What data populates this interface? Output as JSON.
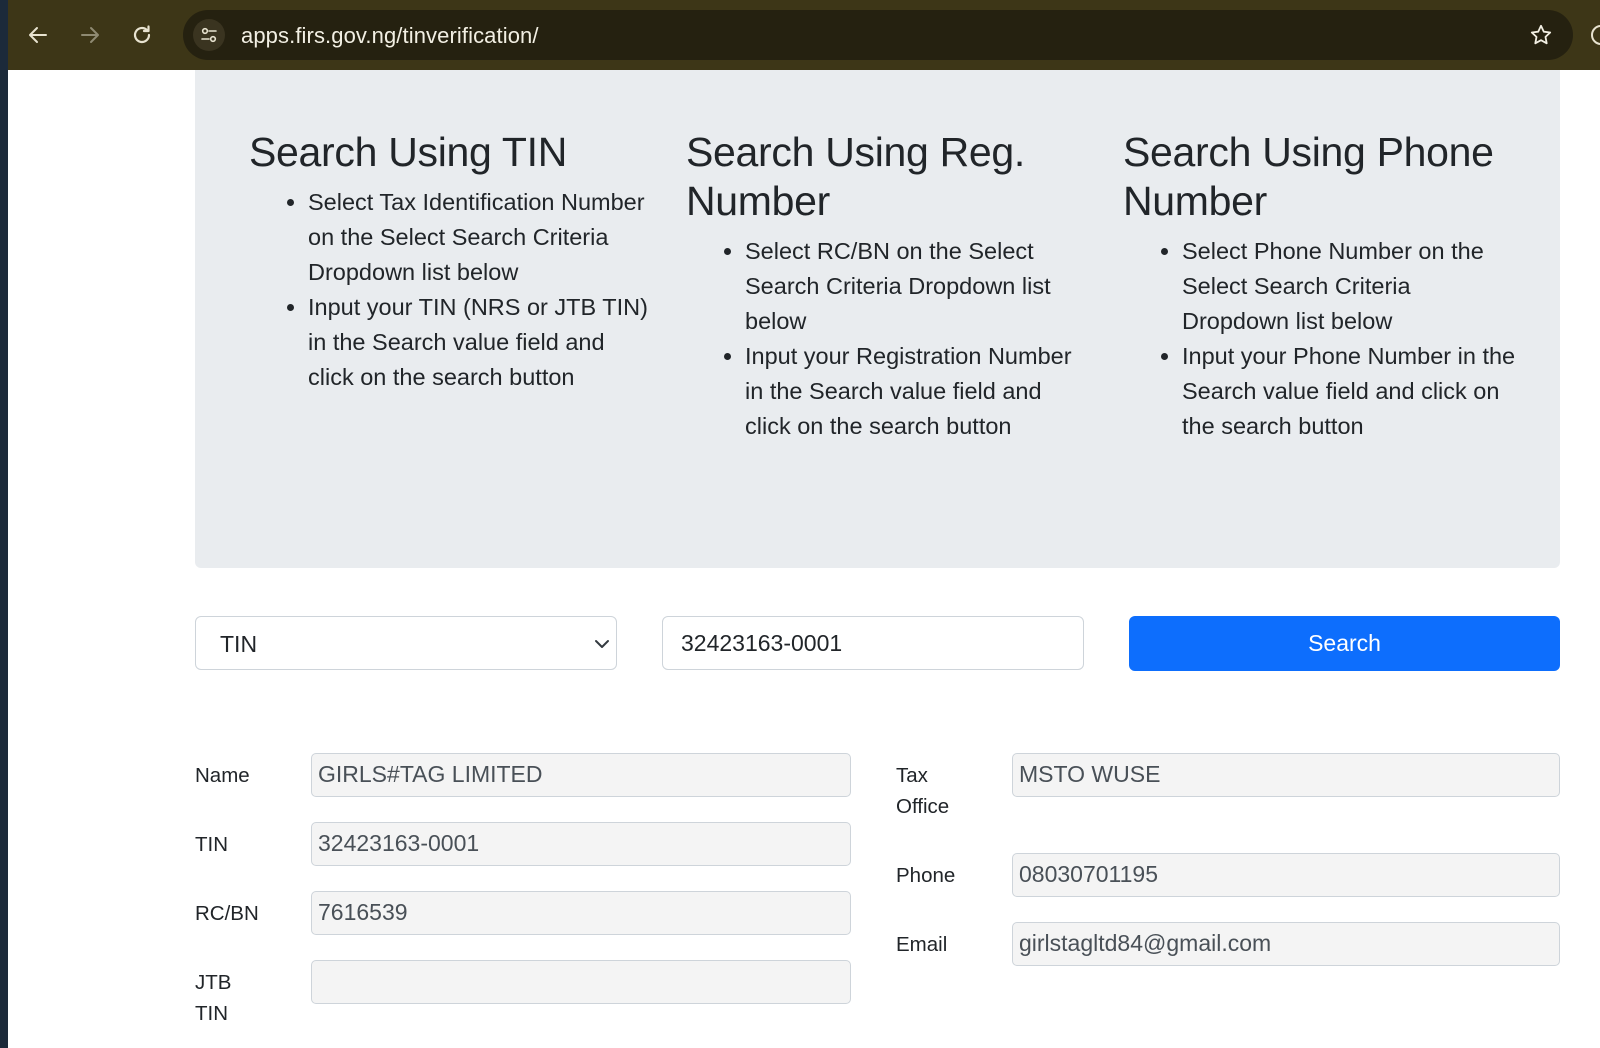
{
  "browser": {
    "url": "apps.firs.gov.ng/tinverification/"
  },
  "instructions": [
    {
      "heading": "Search Using TIN",
      "steps": [
        "Select Tax Identification Number on the Select Search Criteria Dropdown list below",
        "Input your TIN (NRS or JTB TIN) in the Search value field and click on the search button"
      ]
    },
    {
      "heading": "Search Using Reg. Number",
      "steps": [
        "Select RC/BN on the Select Search Criteria Dropdown list below",
        "Input your Registration Number in the Search value field and click on the search button"
      ]
    },
    {
      "heading": "Search Using Phone Number",
      "steps": [
        "Select Phone Number on the Select Search Criteria Dropdown list below",
        "Input your Phone Number in the Search value field and click on the search button"
      ]
    }
  ],
  "search": {
    "criteria_selected": "TIN",
    "value": "32423163-0001",
    "button_label": "Search"
  },
  "result": {
    "name_label": "Name",
    "name_value": "GIRLS#TAG LIMITED",
    "tin_label": "TIN",
    "tin_value": "32423163-0001",
    "rcbn_label": "RC/BN",
    "rcbn_value": "7616539",
    "jtb_label": "JTB TIN",
    "jtb_value": "",
    "tax_office_label": "Tax Office",
    "tax_office_value": "MSTO WUSE",
    "phone_label": "Phone",
    "phone_value": "08030701195",
    "email_label": "Email",
    "email_value": "girlstagltd84@gmail.com"
  },
  "colors": {
    "toolbar": "#3d3617",
    "panel": "#e9ecef",
    "primary": "#0d6efd"
  }
}
